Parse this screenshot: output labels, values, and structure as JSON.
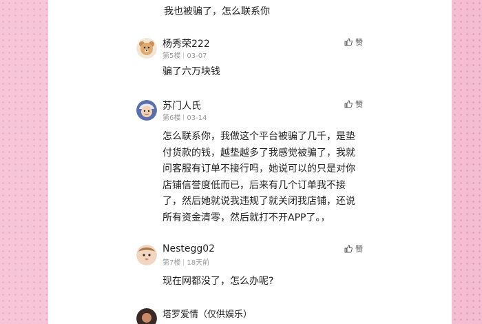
{
  "top_text": "我也被骗了，怎么联系你",
  "comments": [
    {
      "username": "杨秀荣222",
      "floor": "第5楼",
      "date": "03-07",
      "like_label": "赞",
      "lines": [
        "骗了六万块钱"
      ],
      "avatar_icon": "dog-avatar-icon"
    },
    {
      "username": "苏门人氏",
      "floor": "第6楼",
      "date": "03-14",
      "like_label": "赞",
      "lines": [
        "怎么联系你，我做这个平台被骗了几千，是垫",
        "付货款的钱，越垫越多了我感觉被骗了，我就",
        "问客服有订单不接行吗，她说可以的只是对你",
        "店铺信誉度低而已，后来有几个订单我不接",
        "了，然后她就说我违规了就关闭我店铺，还说",
        "所有资金清零，然后就打不开APP了。，"
      ],
      "avatar_icon": "cartoon-avatar-icon"
    },
    {
      "username": "Nestegg02",
      "floor": "第7楼",
      "date": "18天前",
      "like_label": "赞",
      "lines": [
        "现在网都没了，怎么办呢?"
      ],
      "avatar_icon": "baby-avatar-icon"
    },
    {
      "username": "塔罗爱情（仅供娱乐）",
      "floor": "",
      "date": "",
      "like_label": "",
      "lines": [],
      "avatar_icon": "portrait-avatar-icon"
    }
  ]
}
